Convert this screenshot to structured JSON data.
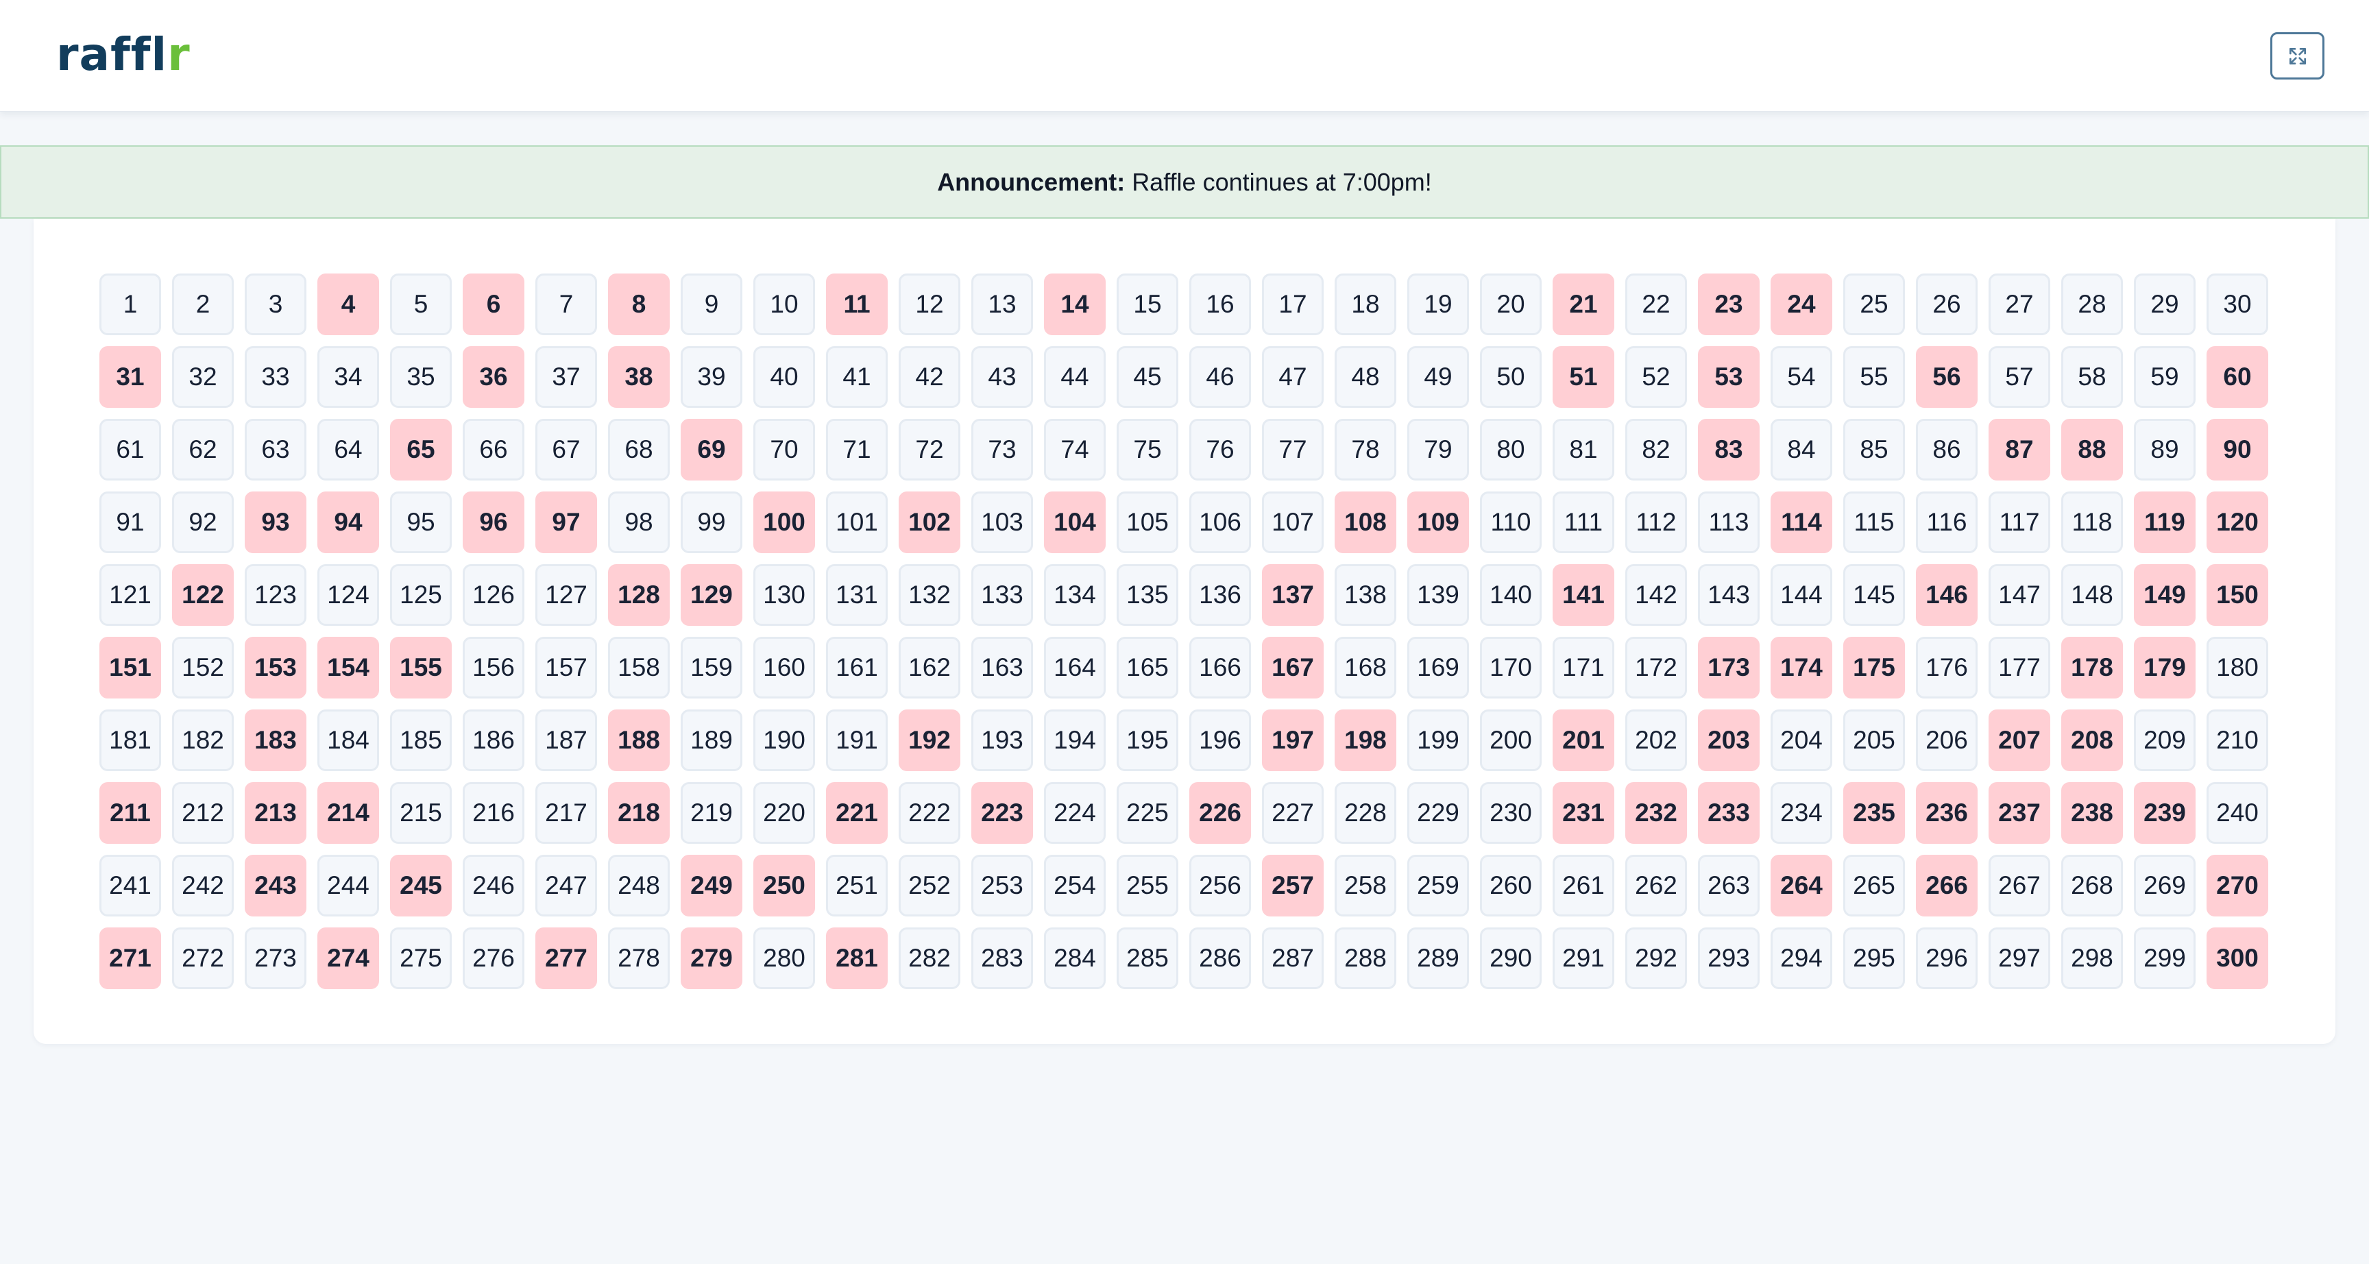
{
  "header": {
    "logo_main": "raffl",
    "logo_accent": "r",
    "expand_button_icon": "expand-icon"
  },
  "announcement": {
    "label": "Announcement:",
    "text": "Raffle continues at 7:00pm!"
  },
  "colors": {
    "taken": "#ffcfd4",
    "available": "#f4f7fb",
    "brand": "#123d5c",
    "brand_accent": "#6abf3a",
    "announcement_bg": "#e6f1e8"
  },
  "board": {
    "total_numbers": 300,
    "columns": 30,
    "taken": [
      4,
      6,
      8,
      11,
      14,
      21,
      23,
      24,
      31,
      36,
      38,
      51,
      53,
      56,
      60,
      65,
      69,
      83,
      87,
      88,
      90,
      93,
      94,
      96,
      97,
      100,
      102,
      104,
      108,
      109,
      114,
      119,
      120,
      122,
      128,
      129,
      137,
      141,
      146,
      149,
      150,
      151,
      153,
      154,
      155,
      167,
      173,
      174,
      175,
      178,
      179,
      183,
      188,
      192,
      197,
      198,
      201,
      203,
      207,
      208,
      211,
      213,
      214,
      218,
      221,
      223,
      226,
      231,
      232,
      233,
      235,
      236,
      237,
      238,
      239,
      243,
      245,
      249,
      250,
      257,
      264,
      266,
      270,
      271,
      274,
      277,
      279,
      281,
      300
    ]
  }
}
